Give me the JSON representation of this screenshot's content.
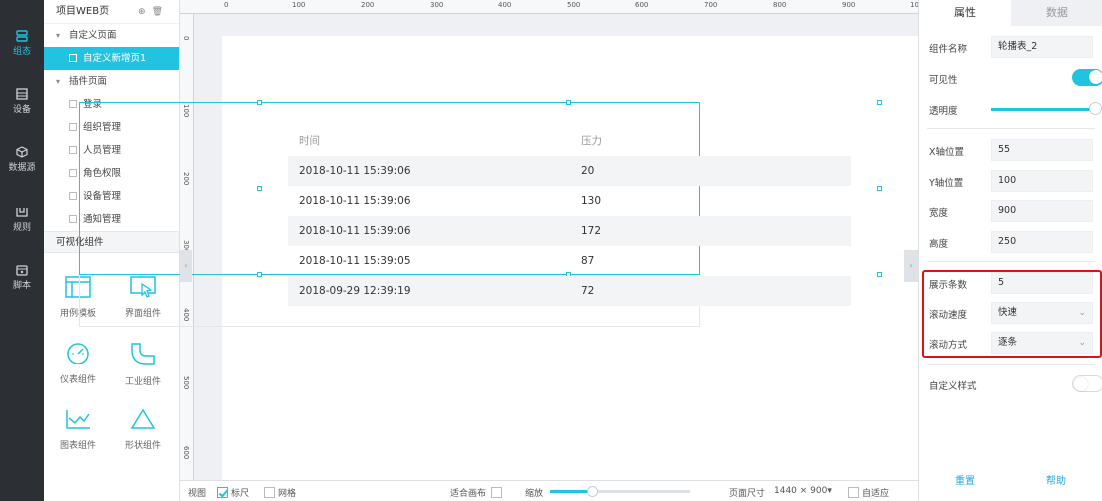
{
  "rail": {
    "items": [
      {
        "label": "组态",
        "icon": "layers-icon",
        "active": true
      },
      {
        "label": "设备",
        "icon": "device-icon",
        "active": false
      },
      {
        "label": "数据源",
        "icon": "cube-icon",
        "active": false
      },
      {
        "label": "规则",
        "icon": "rule-icon",
        "active": false
      },
      {
        "label": "脚本",
        "icon": "script-icon",
        "active": false
      }
    ]
  },
  "tree": {
    "header": "项目WEB页",
    "custom_group": "自定义页面",
    "custom_pages": [
      "自定义新增页1"
    ],
    "plugin_group": "插件页面",
    "plugin_pages": [
      "登录",
      "组织管理",
      "人员管理",
      "角色权限",
      "设备管理",
      "通知管理"
    ],
    "widgets_header": "可视化组件",
    "widgets": [
      "用例模板",
      "界面组件",
      "仪表组件",
      "工业组件",
      "图表组件",
      "形状组件"
    ]
  },
  "ruler": {
    "top": [
      "0",
      "100",
      "200",
      "300",
      "400",
      "500",
      "600",
      "700",
      "800",
      "900",
      "10"
    ],
    "left": [
      "0",
      "100",
      "200",
      "300",
      "400",
      "500",
      "600"
    ]
  },
  "table": {
    "headers": [
      "时间",
      "压力"
    ],
    "rows": [
      [
        "2018-10-11 15:39:06",
        "20"
      ],
      [
        "2018-10-11 15:39:06",
        "130"
      ],
      [
        "2018-10-11 15:39:06",
        "172"
      ],
      [
        "2018-10-11 15:39:05",
        "87"
      ],
      [
        "2018-09-29 12:39:19",
        "72"
      ]
    ]
  },
  "bottombar": {
    "view": "视图",
    "ruler": "标尺",
    "grid": "网格",
    "fit_canvas": "适合画布",
    "zoom": "缩放",
    "zoom_level": 0.3,
    "page_size_label": "页面尺寸",
    "page_size": "1440 × 900",
    "adaptive": "自适应"
  },
  "props": {
    "tab_attr": "属性",
    "tab_data": "数据",
    "name_label": "组件名称",
    "name_value": "轮播表_2",
    "visible_label": "可见性",
    "visible_on": true,
    "opacity_label": "透明度",
    "opacity_level": 1.0,
    "x_label": "X轴位置",
    "x_value": "55",
    "y_label": "Y轴位置",
    "y_value": "100",
    "width_label": "宽度",
    "width_value": "900",
    "height_label": "高度",
    "height_value": "250",
    "count_label": "展示条数",
    "count_value": "5",
    "speed_label": "滚动速度",
    "speed_value": "快速",
    "mode_label": "滚动方式",
    "mode_value": "逐条",
    "custom_style_label": "自定义样式",
    "custom_style_on": false,
    "reset": "重置",
    "help": "帮助"
  },
  "colors": {
    "accent": "#21c3e0",
    "rail_bg": "#2c2f33",
    "highlight": "#e0101a"
  }
}
